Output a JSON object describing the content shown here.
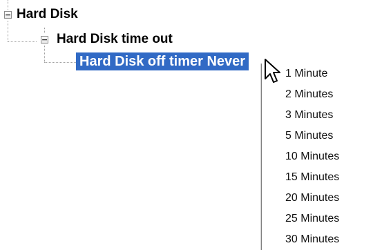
{
  "tree": {
    "nodes": [
      {
        "label": "Hard Disk",
        "expander": "−"
      },
      {
        "label": "Hard Disk time out",
        "expander": "−"
      },
      {
        "label": "Hard Disk off timer Never",
        "selected": true
      }
    ]
  },
  "dropdown": {
    "options": [
      "1 Minute",
      "2 Minutes",
      "3 Minutes",
      "5 Minutes",
      "10 Minutes",
      "15 Minutes",
      "20 Minutes",
      "25 Minutes",
      "30 Minutes"
    ]
  },
  "colors": {
    "selection": "#316ac5",
    "selection_text": "#ffffff"
  },
  "icons": {
    "cursor": "arrow-cursor-icon",
    "expander": "collapse-minus-icon"
  }
}
